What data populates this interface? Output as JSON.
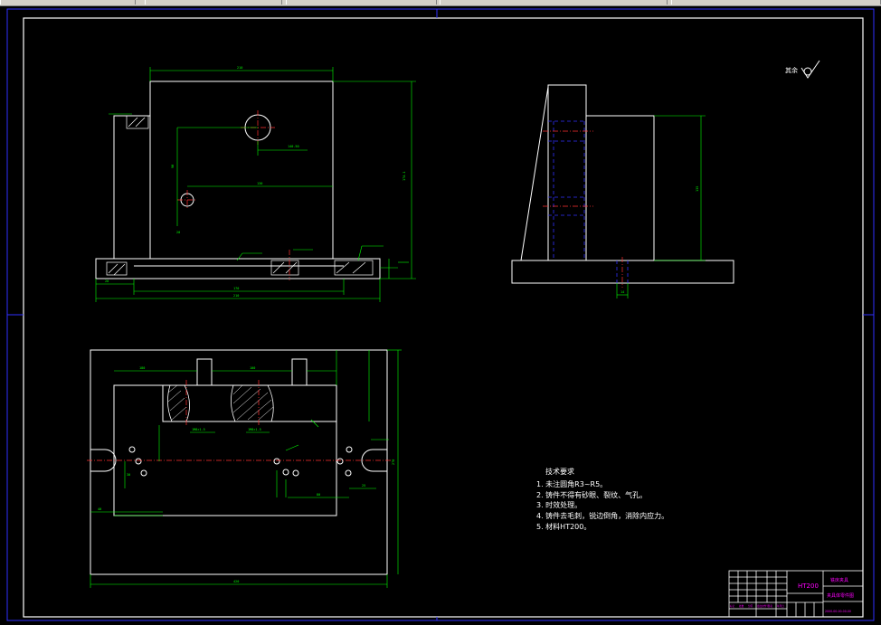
{
  "window": {
    "tabs": [
      "",
      "",
      "",
      "",
      ""
    ]
  },
  "roughness_mark": "其余",
  "tech_requirements": {
    "title": "技术要求",
    "items": [
      "1. 未注圆角R3~R5。",
      "2. 铸件不得有砂眼、裂纹、气孔。",
      "3. 时效处理。",
      "4. 铸件去毛刺，锐边倒角，消除内应力。",
      "5. 材料HT200。"
    ]
  },
  "title_block": {
    "material": "HT200",
    "org": "铣床夹具",
    "part_name": "夹具体零件图",
    "drawing_no": "2000-00-00-00-00",
    "scale_cells": [
      "标记",
      "处数",
      "分区",
      "更改文件号",
      "签名",
      "年月日"
    ]
  },
  "colors": {
    "frame": "#3030ff",
    "outline": "#ffffff",
    "dimension": "#00ff00",
    "centerline": "#ff3030",
    "hidden": "#3030ff",
    "title_text": "#ff00ff"
  }
}
